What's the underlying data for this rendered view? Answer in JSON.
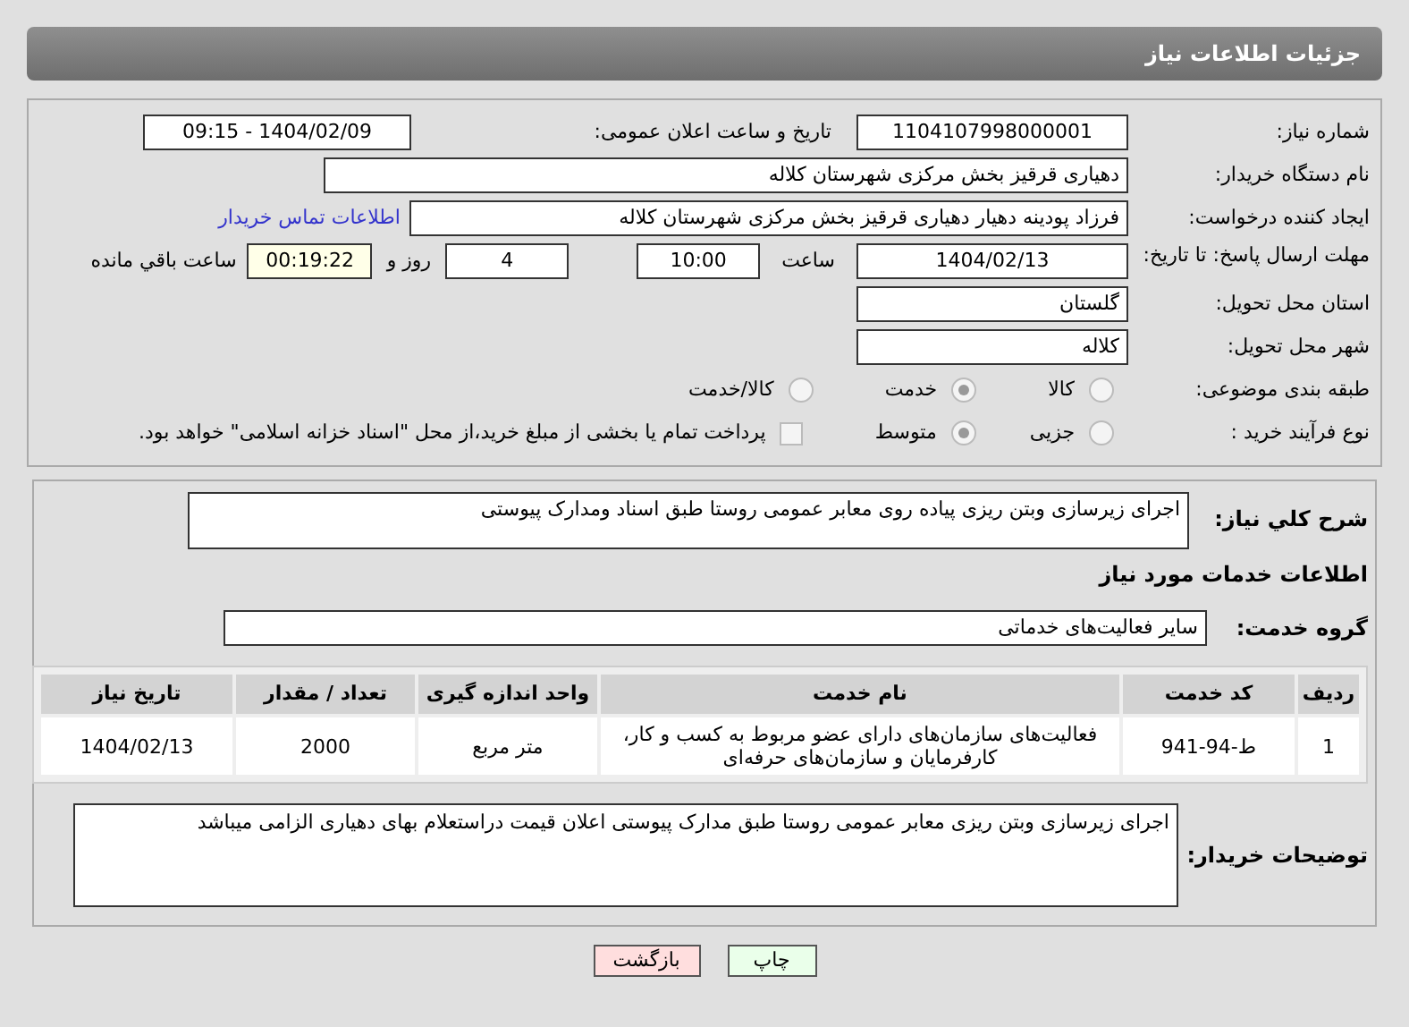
{
  "page_title": "جزئیات اطلاعات نیاز",
  "need_number": {
    "label": "شماره نیاز:",
    "value": "1104107998000001"
  },
  "announce": {
    "label": "تاریخ و ساعت اعلان عمومی:",
    "value": "1404/02/09 - 09:15"
  },
  "buyer": {
    "label": "نام دستگاه خریدار:",
    "value": "دهیاری قرقیز بخش مرکزی شهرستان کلاله"
  },
  "creator": {
    "label": "ایجاد کننده درخواست:",
    "value": "فرزاد پودینه دهیار دهیاری قرقیز بخش مرکزی شهرستان کلاله",
    "link": "اطلاعات تماس خریدار"
  },
  "deadline": {
    "label": "مهلت ارسال پاسخ: تا تاریخ:",
    "date": "1404/02/13",
    "time_label": "ساعت",
    "time": "10:00",
    "days": "4",
    "days_label": "روز و",
    "remaining": "00:19:22",
    "remaining_label": "ساعت باقي مانده"
  },
  "province": {
    "label": "استان محل تحویل:",
    "value": "گلستان"
  },
  "city": {
    "label": "شهر محل تحویل:",
    "value": "کلاله"
  },
  "category": {
    "label": "طبقه بندی موضوعی:",
    "options": [
      {
        "label": "کالا",
        "selected": false
      },
      {
        "label": "خدمت",
        "selected": true
      },
      {
        "label": "کالا/خدمت",
        "selected": false
      }
    ]
  },
  "purchase_type": {
    "label": "نوع فرآیند خرید :",
    "options": [
      {
        "label": "جزیی",
        "selected": false
      },
      {
        "label": "متوسط",
        "selected": true
      }
    ],
    "payment": {
      "label": "پرداخت تمام یا بخشی از مبلغ خرید،از محل \"اسناد خزانه اسلامی\" خواهد بود.",
      "checked": false
    }
  },
  "description": {
    "label": "شرح کلي نياز:",
    "value": "اجرای زیرسازی وبتن ریزی پیاده روی معابر عمومی روستا طبق اسناد ومدارک پیوستی"
  },
  "services_heading": "اطلاعات خدمات مورد نیاز",
  "service_group": {
    "label": "گروه خدمت:",
    "value": "سایر فعالیت‌های خدماتی"
  },
  "table": {
    "columns": [
      "ردیف",
      "کد خدمت",
      "نام خدمت",
      "واحد اندازه گیری",
      "تعداد / مقدار",
      "تاریخ نیاز"
    ],
    "rows": [
      [
        "1",
        "ط-94-941",
        "فعالیت‌های سازمان‌های دارای عضو مربوط به کسب و کار، کارفرمایان و سازمان‌های حرفه‌ای",
        "متر مربع",
        "2000",
        "1404/02/13"
      ]
    ]
  },
  "buyer_notes": {
    "label": "توضیحات خریدار:",
    "value": "اجرای زیرسازی وبتن ریزی معابر عمومی روستا طبق مدارک پیوستی اعلان قیمت دراستعلام بهای دهیاری الزامی میباشد"
  },
  "buttons": [
    {
      "label": "چاپ",
      "kind": "print"
    },
    {
      "label": "بازگشت",
      "kind": "back"
    }
  ]
}
